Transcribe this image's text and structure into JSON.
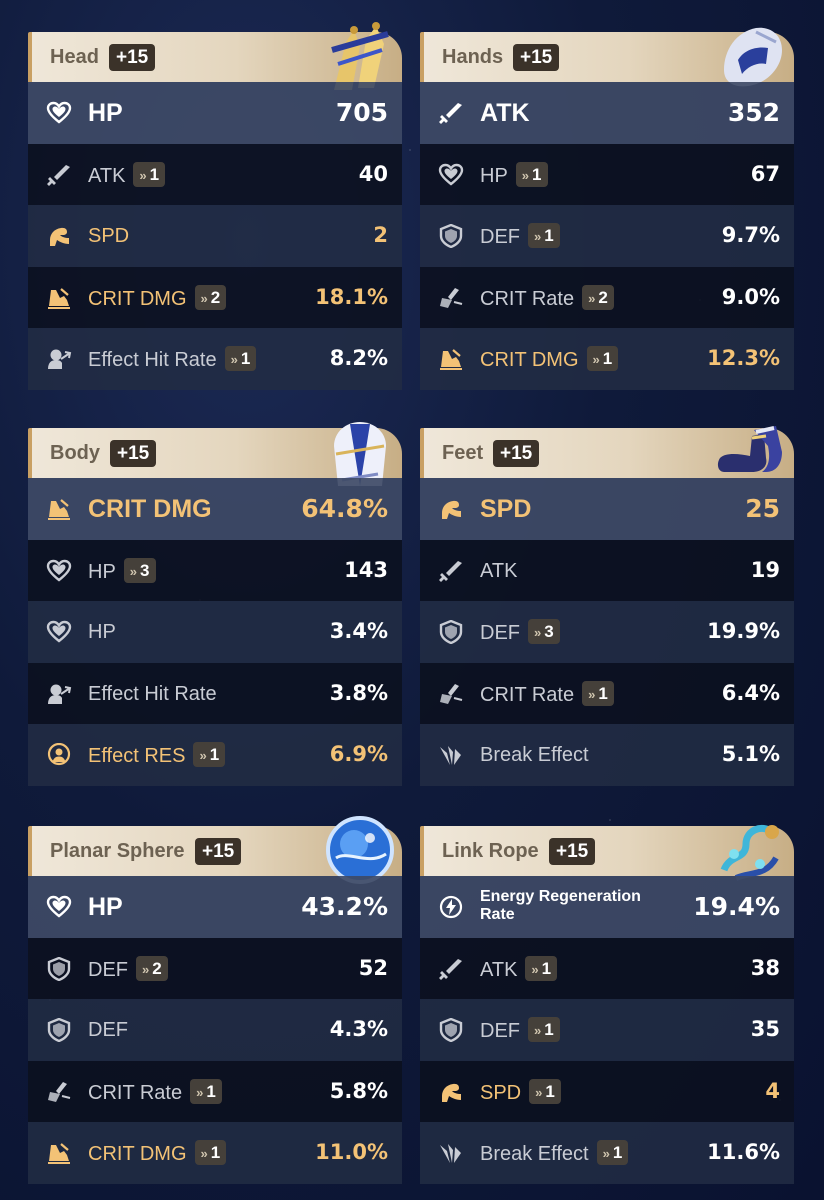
{
  "roll_prefix": "»",
  "colors": {
    "gold": "#f3c276",
    "white": "#ffffff",
    "gray": "#c9ccd4"
  },
  "relics": [
    {
      "slot": "Head",
      "level": "+15",
      "image": "head-relic-icon",
      "main": {
        "icon": "hp-icon",
        "name": "HP",
        "value": "705",
        "gold": false
      },
      "subs": [
        {
          "icon": "atk-icon",
          "name": "ATK",
          "rolls": "1",
          "value": "40",
          "gold": false
        },
        {
          "icon": "spd-icon",
          "name": "SPD",
          "rolls": "",
          "value": "2",
          "gold": true
        },
        {
          "icon": "crit-dmg-icon",
          "name": "CRIT DMG",
          "rolls": "2",
          "value": "18.1%",
          "gold": true
        },
        {
          "icon": "effect-hit-rate-icon",
          "name": "Effect Hit Rate",
          "rolls": "1",
          "value": "8.2%",
          "gold": false
        }
      ]
    },
    {
      "slot": "Hands",
      "level": "+15",
      "image": "hands-relic-icon",
      "main": {
        "icon": "atk-icon",
        "name": "ATK",
        "value": "352",
        "gold": false
      },
      "subs": [
        {
          "icon": "hp-icon",
          "name": "HP",
          "rolls": "1",
          "value": "67",
          "gold": false
        },
        {
          "icon": "def-icon",
          "name": "DEF",
          "rolls": "1",
          "value": "9.7%",
          "gold": false
        },
        {
          "icon": "crit-rate-icon",
          "name": "CRIT Rate",
          "rolls": "2",
          "value": "9.0%",
          "gold": false
        },
        {
          "icon": "crit-dmg-icon",
          "name": "CRIT DMG",
          "rolls": "1",
          "value": "12.3%",
          "gold": true
        }
      ]
    },
    {
      "slot": "Body",
      "level": "+15",
      "image": "body-relic-icon",
      "main": {
        "icon": "crit-dmg-icon",
        "name": "CRIT DMG",
        "value": "64.8%",
        "gold": true
      },
      "subs": [
        {
          "icon": "hp-icon",
          "name": "HP",
          "rolls": "3",
          "value": "143",
          "gold": false
        },
        {
          "icon": "hp-icon",
          "name": "HP",
          "rolls": "",
          "value": "3.4%",
          "gold": false
        },
        {
          "icon": "effect-hit-rate-icon",
          "name": "Effect Hit Rate",
          "rolls": "",
          "value": "3.8%",
          "gold": false
        },
        {
          "icon": "effect-res-icon",
          "name": "Effect RES",
          "rolls": "1",
          "value": "6.9%",
          "gold": true
        }
      ]
    },
    {
      "slot": "Feet",
      "level": "+15",
      "image": "feet-relic-icon",
      "main": {
        "icon": "spd-icon",
        "name": "SPD",
        "value": "25",
        "gold": true
      },
      "subs": [
        {
          "icon": "atk-icon",
          "name": "ATK",
          "rolls": "",
          "value": "19",
          "gold": false
        },
        {
          "icon": "def-icon",
          "name": "DEF",
          "rolls": "3",
          "value": "19.9%",
          "gold": false
        },
        {
          "icon": "crit-rate-icon",
          "name": "CRIT Rate",
          "rolls": "1",
          "value": "6.4%",
          "gold": false
        },
        {
          "icon": "break-effect-icon",
          "name": "Break Effect",
          "rolls": "",
          "value": "5.1%",
          "gold": false
        }
      ]
    },
    {
      "slot": "Planar Sphere",
      "level": "+15",
      "image": "planar-sphere-relic-icon",
      "main": {
        "icon": "hp-icon",
        "name": "HP",
        "value": "43.2%",
        "gold": false
      },
      "subs": [
        {
          "icon": "def-icon",
          "name": "DEF",
          "rolls": "2",
          "value": "52",
          "gold": false
        },
        {
          "icon": "def-icon",
          "name": "DEF",
          "rolls": "",
          "value": "4.3%",
          "gold": false
        },
        {
          "icon": "crit-rate-icon",
          "name": "CRIT Rate",
          "rolls": "1",
          "value": "5.8%",
          "gold": false
        },
        {
          "icon": "crit-dmg-icon",
          "name": "CRIT DMG",
          "rolls": "1",
          "value": "11.0%",
          "gold": true
        }
      ]
    },
    {
      "slot": "Link Rope",
      "level": "+15",
      "image": "link-rope-relic-icon",
      "main": {
        "icon": "energy-regeneration-icon",
        "name": "Energy Regeneration Rate",
        "value": "19.4%",
        "gold": false
      },
      "subs": [
        {
          "icon": "atk-icon",
          "name": "ATK",
          "rolls": "1",
          "value": "38",
          "gold": false
        },
        {
          "icon": "def-icon",
          "name": "DEF",
          "rolls": "1",
          "value": "35",
          "gold": false
        },
        {
          "icon": "spd-icon",
          "name": "SPD",
          "rolls": "1",
          "value": "4",
          "gold": true
        },
        {
          "icon": "break-effect-icon",
          "name": "Break Effect",
          "rolls": "1",
          "value": "11.6%",
          "gold": false
        }
      ]
    }
  ]
}
